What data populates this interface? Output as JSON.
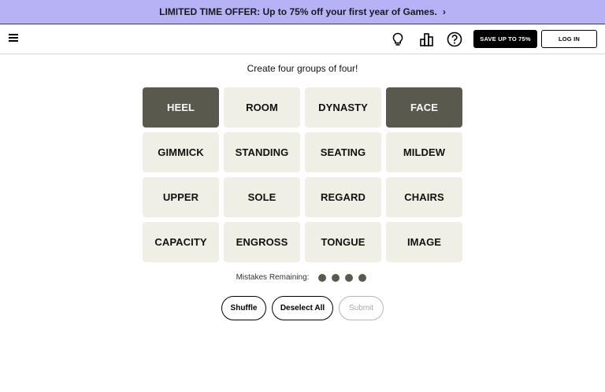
{
  "promo": {
    "text": "LIMITED TIME OFFER: Up to 75% off your first year of Games.",
    "chevron": "›"
  },
  "nav": {
    "menu_icon": "hamburger-icon",
    "hint_icon": "lightbulb-icon",
    "stats_icon": "bar-chart-icon",
    "help_icon": "question-circle-icon",
    "save_label": "SAVE UP TO 75%",
    "login_label": "LOG IN"
  },
  "game": {
    "instructions": "Create four groups of four!",
    "tiles": [
      {
        "word": "HEEL",
        "selected": true
      },
      {
        "word": "ROOM",
        "selected": false
      },
      {
        "word": "DYNASTY",
        "selected": false
      },
      {
        "word": "FACE",
        "selected": true
      },
      {
        "word": "GIMMICK",
        "selected": false
      },
      {
        "word": "STANDING",
        "selected": false
      },
      {
        "word": "SEATING",
        "selected": false
      },
      {
        "word": "MILDEW",
        "selected": false
      },
      {
        "word": "UPPER",
        "selected": false
      },
      {
        "word": "SOLE",
        "selected": false
      },
      {
        "word": "REGARD",
        "selected": false
      },
      {
        "word": "CHAIRS",
        "selected": false
      },
      {
        "word": "CAPACITY",
        "selected": false
      },
      {
        "word": "ENGROSS",
        "selected": false
      },
      {
        "word": "TONGUE",
        "selected": false
      },
      {
        "word": "IMAGE",
        "selected": false
      }
    ],
    "mistakes_label": "Mistakes Remaining:",
    "mistakes_remaining": 4,
    "buttons": {
      "shuffle": "Shuffle",
      "deselect": "Deselect All",
      "submit": "Submit"
    }
  },
  "colors": {
    "promo_bg": "#b7b1f5",
    "tile_bg": "#efefe6",
    "tile_selected_bg": "#5a594e"
  }
}
